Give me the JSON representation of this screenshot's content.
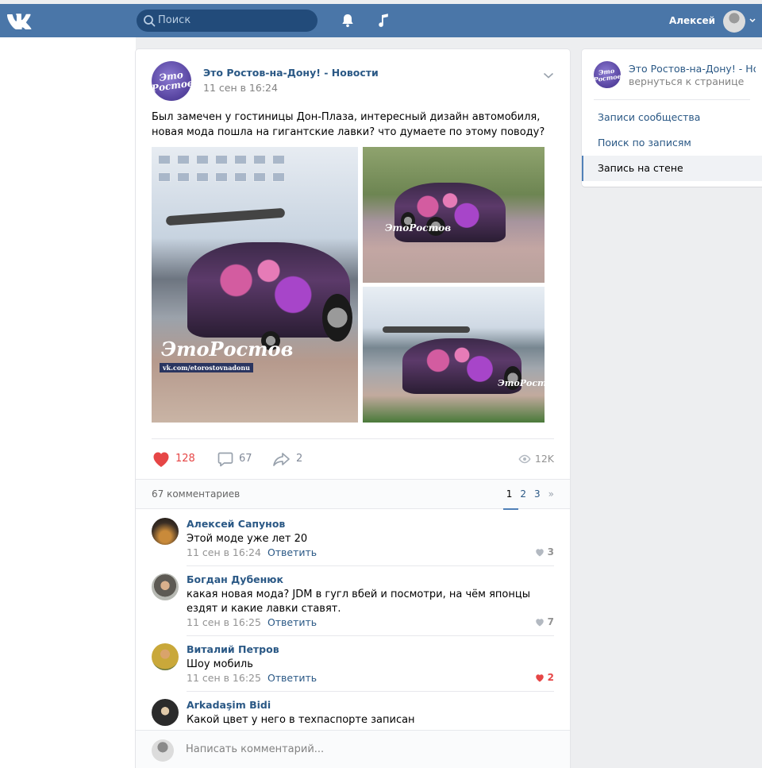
{
  "header": {
    "search_placeholder": "Поиск",
    "user_name": "Алексей"
  },
  "post": {
    "author": "Это Ростов-на-Дону! - Новости",
    "avatar_text": "Это Ростов",
    "date": "11 сен в 16:24",
    "text": "Был замечен у гостиницы Дон-Плаза, интересный дизайн автомобиля, новая мода пошла на гигантские лавки? что думаете по этому поводу?",
    "watermark_main": "ЭтоРостов",
    "watermark_url": "vk.com/etorostovnadonu",
    "likes": "128",
    "comments": "67",
    "shares": "2",
    "views": "12K"
  },
  "comments_section": {
    "count_label": "67 комментариев",
    "pages": [
      "1",
      "2",
      "3"
    ],
    "next": "»",
    "items": [
      {
        "name": "Алексей Сапунов",
        "text": "Этой моде уже лет 20",
        "date": "11 сен в 16:24",
        "reply": "Ответить",
        "likes": "3",
        "liked": false
      },
      {
        "name": "Богдан Дубенюк",
        "text": "какая новая мода? JDM в гугл вбей и посмотри, на чём японцы ездят и какие лавки ставят.",
        "date": "11 сен в 16:25",
        "reply": "Ответить",
        "likes": "7",
        "liked": false
      },
      {
        "name": "Виталий Петров",
        "text": "Шоу мобиль",
        "date": "11 сен в 16:25",
        "reply": "Ответить",
        "likes": "2",
        "liked": true
      },
      {
        "name": "Arkadaşim Bidi",
        "text": "Какой цвет у него в техпаспорте записан",
        "date": "",
        "reply": "",
        "likes": "",
        "liked": false
      }
    ],
    "reply_placeholder": "Написать комментарий..."
  },
  "sidebar": {
    "group_name": "Это Ростов-на-Дону! - Новости",
    "back_label": "вернуться к странице",
    "items": [
      {
        "label": "Записи сообщества",
        "active": false
      },
      {
        "label": "Поиск по записям",
        "active": false
      },
      {
        "label": "Запись на стене",
        "active": true
      }
    ]
  },
  "colors": {
    "header": "#4a76a8",
    "link": "#2a5885",
    "like_red": "#e64646",
    "background": "#edeef0"
  }
}
